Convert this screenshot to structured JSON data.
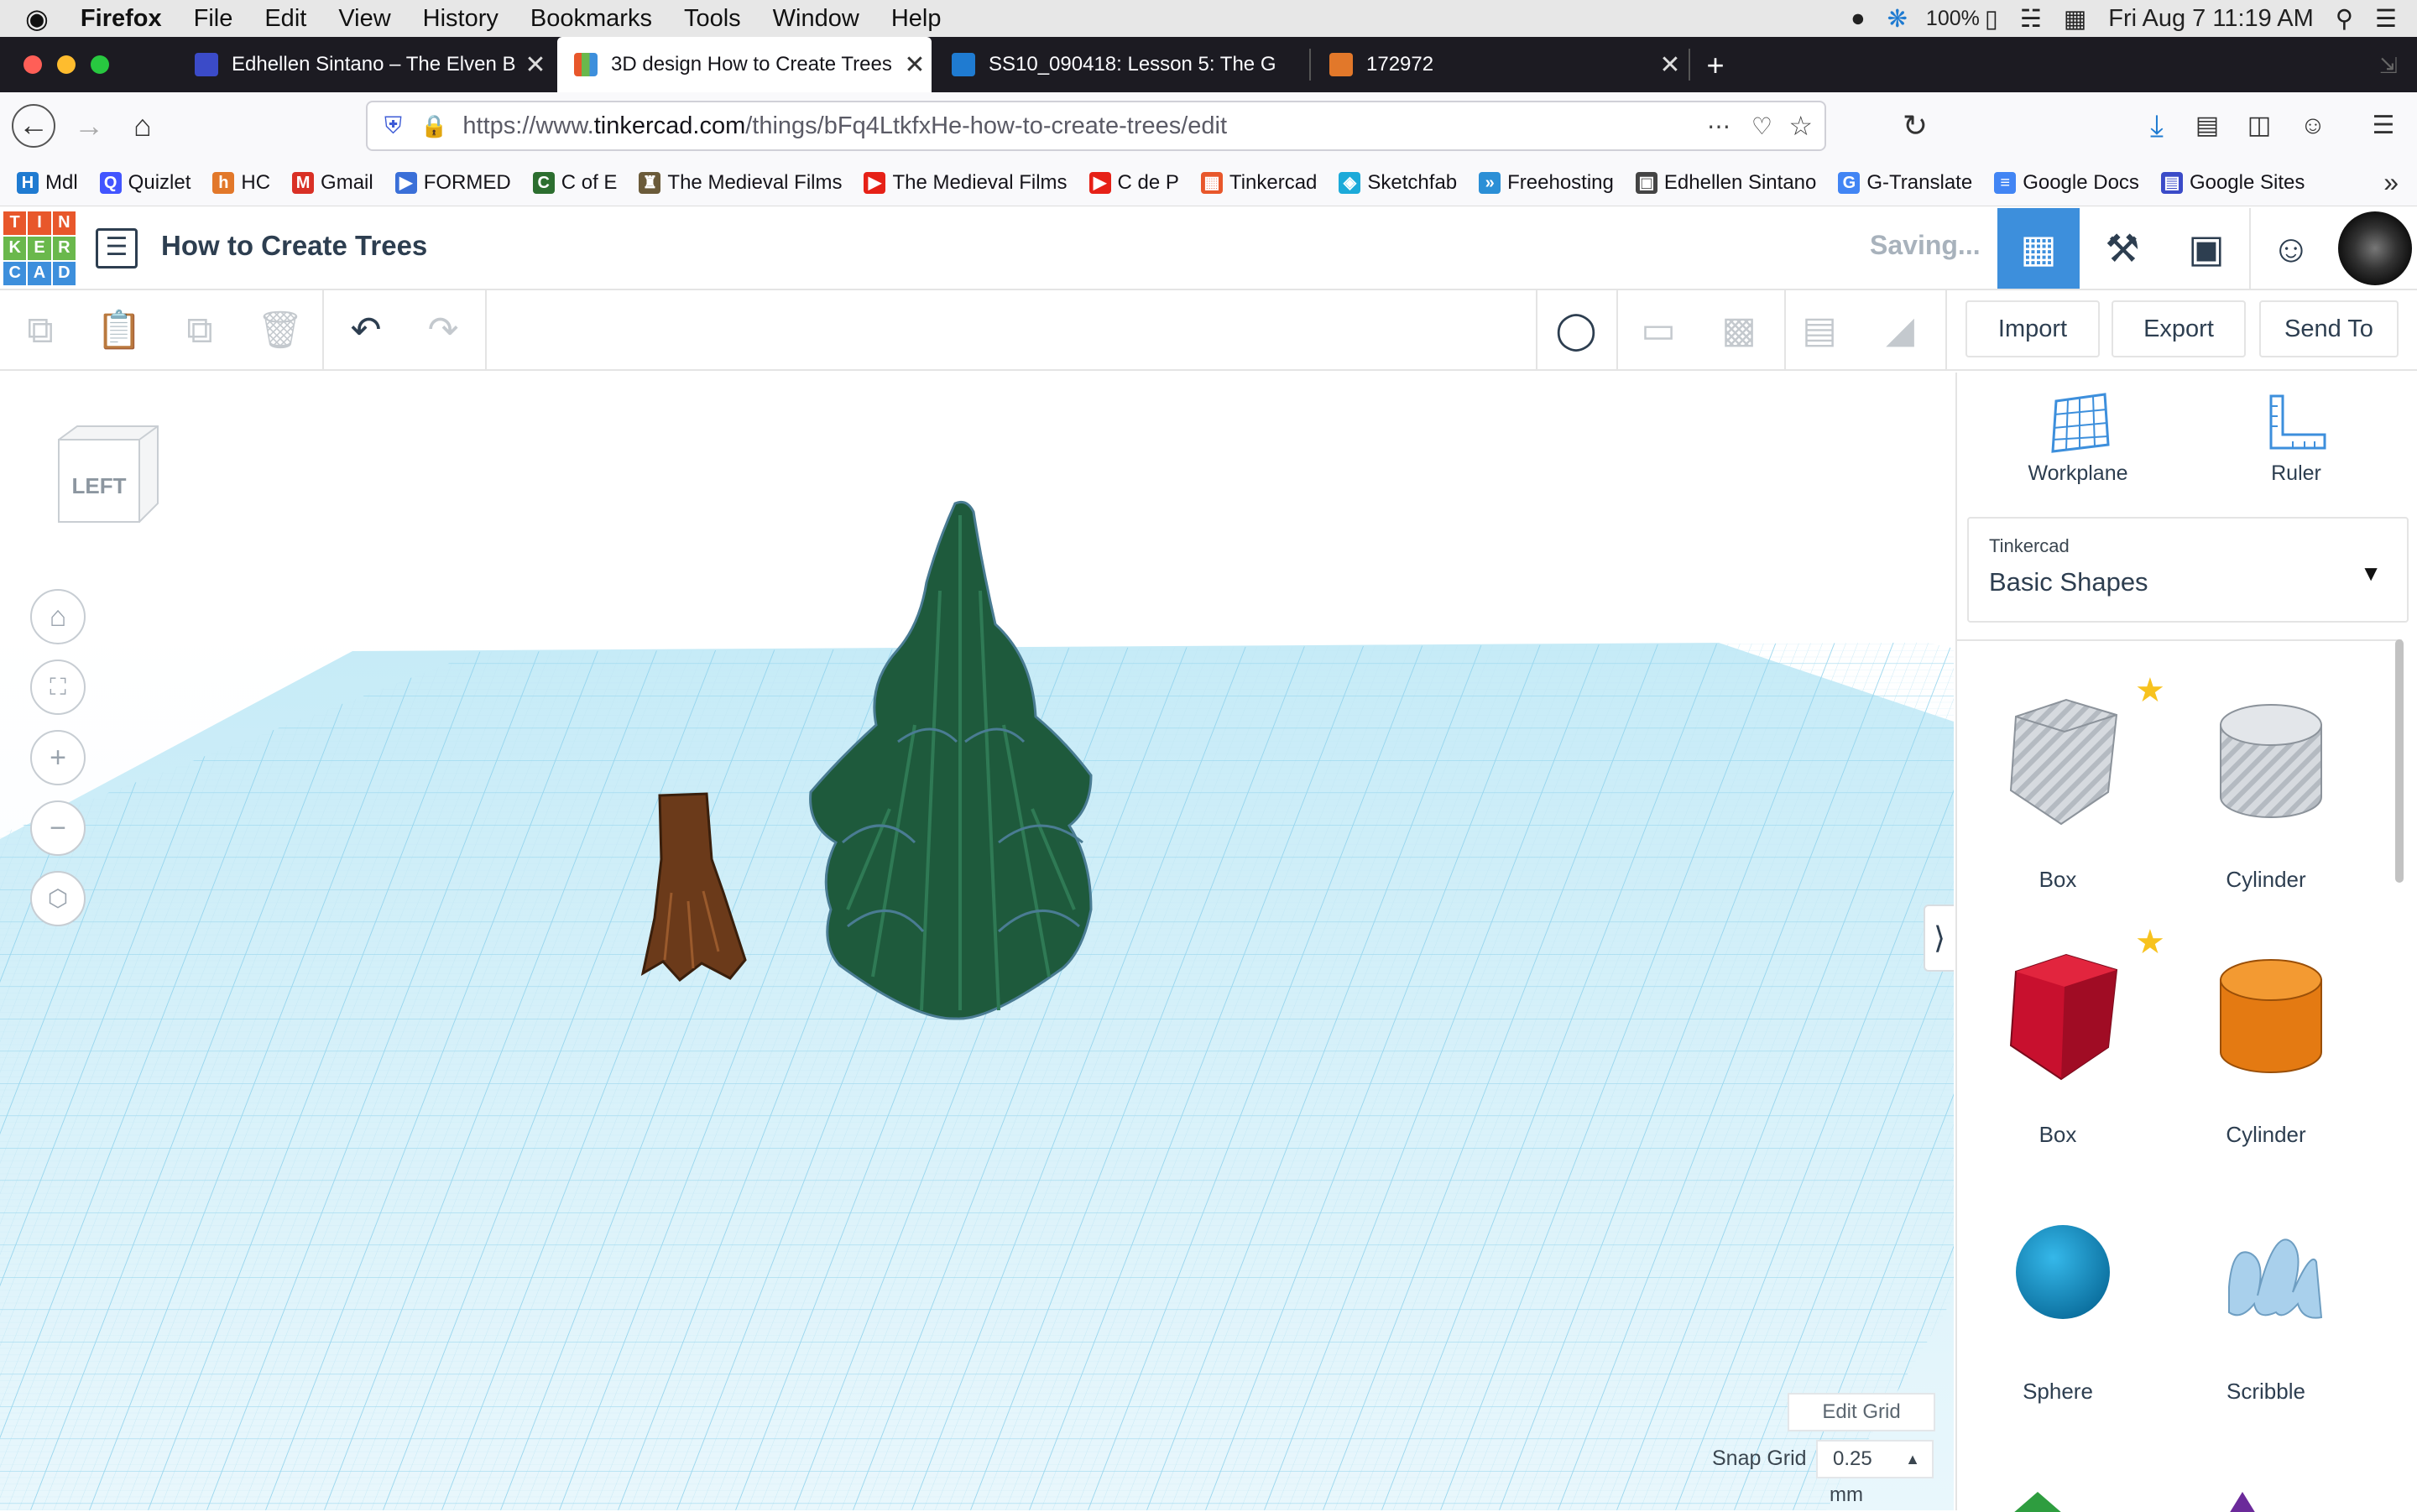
{
  "menubar": {
    "apple": "",
    "app": "Firefox",
    "items": [
      "File",
      "Edit",
      "View",
      "History",
      "Bookmarks",
      "Tools",
      "Window",
      "Help"
    ],
    "battery": "100%",
    "clock": "Fri Aug 7  11:19 AM"
  },
  "tabs": [
    {
      "title": "Edhellen Sintano – The Elven B",
      "fav_color": "#3b4bc8"
    },
    {
      "title": "3D design How to Create Trees",
      "fav_color": "#e8572b"
    },
    {
      "title": "SS10_090418: Lesson 5: The G",
      "fav_color": "#1f7bd1"
    },
    {
      "title": "172972",
      "fav_color": "#e2782a"
    }
  ],
  "url": {
    "prefix": "https://www.",
    "domain": "tinkercad.com",
    "path": "/things/bFq4LtkfxHe-how-to-create-trees/edit"
  },
  "bookmarks": [
    {
      "label": "Mdl",
      "color": "#1f7bd1",
      "glyph": "H"
    },
    {
      "label": "Quizlet",
      "color": "#4255ff",
      "glyph": "Q"
    },
    {
      "label": "HC",
      "color": "#e2782a",
      "glyph": "h"
    },
    {
      "label": "Gmail",
      "color": "#d93025",
      "glyph": "M"
    },
    {
      "label": "FORMED",
      "color": "#3a6fd8",
      "glyph": "▶"
    },
    {
      "label": "C of E",
      "color": "#2c6e2f",
      "glyph": "C"
    },
    {
      "label": "The Medieval Films",
      "color": "#6b5b3a",
      "glyph": "♜"
    },
    {
      "label": "The Medieval Films",
      "color": "#e62117",
      "glyph": "▶"
    },
    {
      "label": "C de P",
      "color": "#e62117",
      "glyph": "▶"
    },
    {
      "label": "Tinkercad",
      "color": "#e8572b",
      "glyph": "▦"
    },
    {
      "label": "Sketchfab",
      "color": "#1caad9",
      "glyph": "◈"
    },
    {
      "label": "Freehosting",
      "color": "#2b8fd6",
      "glyph": "»"
    },
    {
      "label": "Edhellen Sintano",
      "color": "#444",
      "glyph": "▣"
    },
    {
      "label": "G-Translate",
      "color": "#4285f4",
      "glyph": "G"
    },
    {
      "label": "Google Docs",
      "color": "#4285f4",
      "glyph": "≡"
    },
    {
      "label": "Google Sites",
      "color": "#3b4bc8",
      "glyph": "▤"
    }
  ],
  "logo_letters": [
    "T",
    "I",
    "N",
    "K",
    "E",
    "R",
    "C",
    "A",
    "D"
  ],
  "header": {
    "title": "How to Create Trees",
    "status": "Saving..."
  },
  "toolbar": {
    "import": "Import",
    "export": "Export",
    "send_to": "Send To"
  },
  "viewcube": {
    "face": "LEFT"
  },
  "grid": {
    "edit_label": "Edit Grid",
    "snap_label": "Snap Grid",
    "snap_value": "0.25",
    "unit": "mm"
  },
  "sidebar": {
    "workplane": "Workplane",
    "ruler": "Ruler",
    "library_source": "Tinkercad",
    "library_name": "Basic Shapes",
    "shapes": [
      {
        "label": "Box",
        "kind": "box-hole",
        "starred": true
      },
      {
        "label": "Cylinder",
        "kind": "cylinder-hole",
        "starred": false
      },
      {
        "label": "Box",
        "kind": "box",
        "starred": true
      },
      {
        "label": "Cylinder",
        "kind": "cylinder",
        "starred": false
      },
      {
        "label": "Sphere",
        "kind": "sphere",
        "starred": false
      },
      {
        "label": "Scribble",
        "kind": "scribble",
        "starred": false
      }
    ]
  },
  "colors": {
    "tinkercad_blue": "#3d8fdc",
    "grid": "#8fd2ec",
    "tree": "#1e5a3c",
    "trunk": "#6b3a1a"
  }
}
